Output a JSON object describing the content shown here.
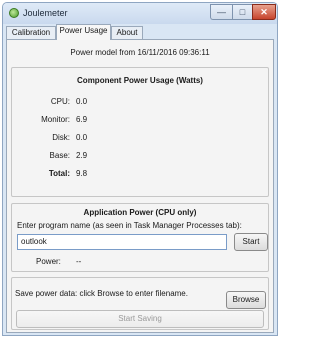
{
  "window": {
    "title": "Joulemeter"
  },
  "tabs": [
    {
      "label": "Calibration"
    },
    {
      "label": "Power Usage"
    },
    {
      "label": "About"
    }
  ],
  "power_model_line": "Power model from 16/11/2016 09:36:11",
  "component_usage": {
    "heading": "Component Power Usage (Watts)",
    "rows": [
      {
        "label": "CPU:",
        "value": "0.0"
      },
      {
        "label": "Monitor:",
        "value": "6.9"
      },
      {
        "label": "Disk:",
        "value": "0.0"
      },
      {
        "label": "Base:",
        "value": "2.9"
      },
      {
        "label": "Total:",
        "value": "9.8"
      }
    ]
  },
  "application_power": {
    "heading": "Application Power (CPU only)",
    "instruction": "Enter program name (as seen in Task Manager Processes tab):",
    "program_input_value": "outlook",
    "start_label": "Start",
    "power_label": "Power:",
    "power_value": "--"
  },
  "save_section": {
    "instruction": "Save power data: click Browse to enter filename.",
    "browse_label": "Browse",
    "start_saving_label": "Start Saving"
  }
}
